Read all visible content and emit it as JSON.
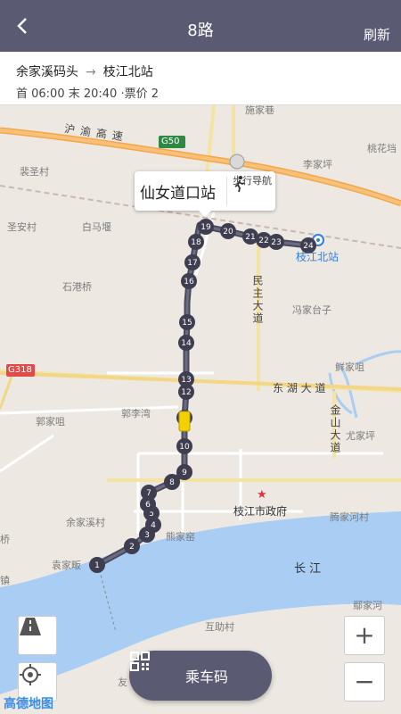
{
  "header": {
    "title": "8路",
    "refresh_label": "刷新",
    "back_icon": "back-arrow-icon"
  },
  "route": {
    "from": "余家溪码头",
    "to": "枝江北站",
    "times": "首 06:00 末 20:40 ·票价 2"
  },
  "map": {
    "labels": {
      "top_cut": "施家巷",
      "expressway": "沪渝高速",
      "g50": "G50",
      "g318": "G318",
      "taohua": "桃花垱",
      "lijiaping": "李家坪",
      "peisheng": "裴圣村",
      "shengan": "圣安村",
      "baima": "白马堰",
      "shigang": "石港桥",
      "minzhu": "民主大道",
      "fengjiatai": "冯家台子",
      "xianjiaju": "鲜家咀",
      "donghu": "东 湖 大 道",
      "jinshan": "金山大道",
      "guojiaju": "郭家咀",
      "guoli": "郭李湾",
      "youjiaping": "尤家坪",
      "gov": "枝江市政府",
      "yujiaxi": "余家溪村",
      "xiongjia": "熊家窑",
      "tengjia": "腾家河村",
      "yuanjia": "袁家畈",
      "changjiang": "长 江",
      "qiao": "桥",
      "zhen": "镇",
      "ejiahe": "鄢家河",
      "huzhu": "互助村",
      "you": "友",
      "hanjiang": "沪渝"
    },
    "selected_stop": "仙女道口站",
    "walk_nav_label": "步行导航",
    "end_stop_label": "枝江北站",
    "stops": [
      "1",
      "2",
      "3",
      "4",
      "5",
      "6",
      "7",
      "8",
      "9",
      "10",
      "11",
      "12",
      "13",
      "14",
      "15",
      "16",
      "17",
      "18",
      "19",
      "20",
      "21",
      "22",
      "23",
      "24"
    ]
  },
  "controls": {
    "qr_label": "乘车码",
    "logo_text": "高德地图",
    "zoom_in": "+",
    "zoom_out": "−"
  },
  "colors": {
    "header_bg": "#5a5a72",
    "route_line": "#4a4a5e",
    "water": "#a9cdf3",
    "expressway": "#f6b35c",
    "accent_blue": "#2f7fe0"
  }
}
